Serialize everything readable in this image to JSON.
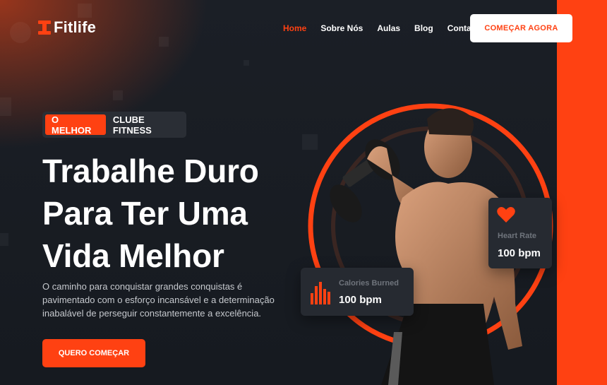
{
  "brand": {
    "name": "Fitlife",
    "accent": "#ff4112"
  },
  "nav": {
    "items": [
      {
        "label": "Home",
        "active": true
      },
      {
        "label": "Sobre Nós",
        "active": false
      },
      {
        "label": "Aulas",
        "active": false
      },
      {
        "label": "Blog",
        "active": false
      },
      {
        "label": "Contato",
        "active": false
      }
    ],
    "cta_label": "COMEÇAR AGORA"
  },
  "hero": {
    "tag_highlight": "O MELHOR",
    "tag_rest": "CLUBE FITNESS",
    "headline_line1": "Trabalhe Duro",
    "headline_line2": "Para Ter Uma",
    "headline_line3": "Vida Melhor",
    "paragraph": "O caminho para conquistar grandes conquistas é pavimentado com o esforço incansável e a determinação inabalável de perseguir constantemente a excelência.",
    "cta_label": "QUERO COMEÇAR"
  },
  "stats": {
    "calories": {
      "label": "Calories Burned",
      "value": "100 bpm",
      "icon": "bar-chart-icon"
    },
    "heart": {
      "label": "Heart Rate",
      "value": "100 bpm",
      "icon": "heart-icon"
    }
  }
}
